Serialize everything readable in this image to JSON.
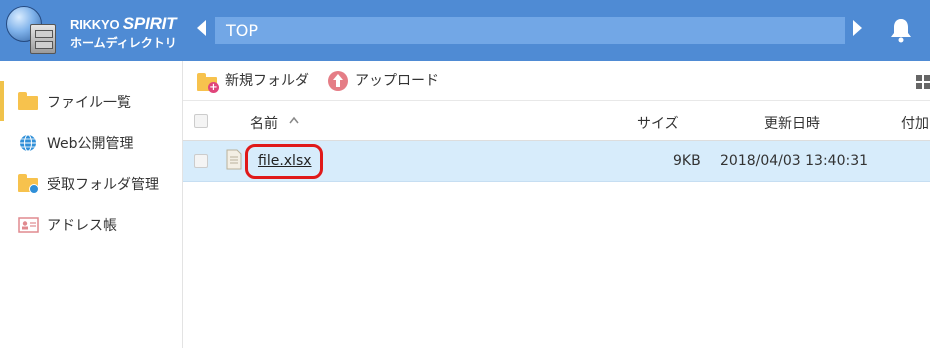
{
  "header": {
    "logo_line1_a": "RIKKYO ",
    "logo_line1_b": "SPIRIT",
    "logo_line2": "ホームディレクトリ",
    "path": "TOP",
    "icons": [
      "chevron-left-icon",
      "chevron-right-icon",
      "bell-icon"
    ]
  },
  "sidebar": {
    "items": [
      {
        "label": "ファイル一覧",
        "icon": "folder-icon",
        "active": true
      },
      {
        "label": "Web公開管理",
        "icon": "globe-icon",
        "active": false
      },
      {
        "label": "受取フォルダ管理",
        "icon": "shared-folder-icon",
        "active": false
      },
      {
        "label": "アドレス帳",
        "icon": "address-card-icon",
        "active": false
      }
    ]
  },
  "toolbar": {
    "new_folder_label": "新規フォルダ",
    "upload_label": "アップロード"
  },
  "table": {
    "columns": [
      "名前",
      "サイズ",
      "更新日時",
      "付加"
    ],
    "sort": "ascending",
    "rows": [
      {
        "name": "file.xlsx",
        "size": "9KB",
        "modified": "2018/04/03 13:40:31",
        "selected": true
      }
    ]
  },
  "colors": {
    "header_bg": "#4f8bd4",
    "path_bg": "#72a7e6",
    "selected_row": "#d7ecfb",
    "highlight_outline": "#e01919",
    "folder": "#f7c24d",
    "upload": "#e57d86"
  }
}
